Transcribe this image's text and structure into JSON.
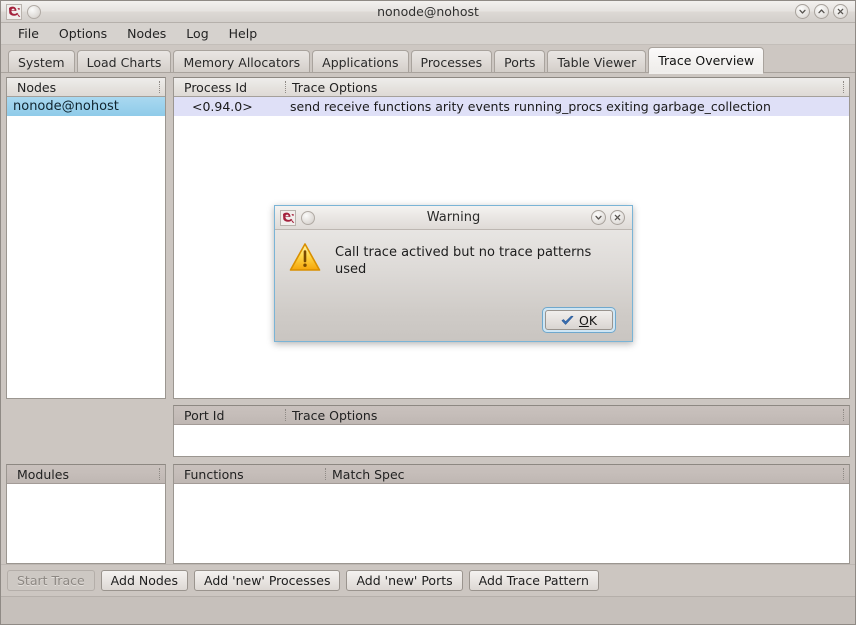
{
  "window": {
    "title": "nonode@nohost",
    "app_icon": "erlang-logo-icon",
    "controls": [
      {
        "name": "minimize",
        "glyph": "chevron-down-icon"
      },
      {
        "name": "maximize",
        "glyph": "chevron-up-icon"
      },
      {
        "name": "close",
        "glyph": "close-x-icon"
      }
    ]
  },
  "menubar": {
    "items": [
      {
        "label": "File"
      },
      {
        "label": "Options"
      },
      {
        "label": "Nodes"
      },
      {
        "label": "Log"
      },
      {
        "label": "Help"
      }
    ]
  },
  "tabs": {
    "active": "Trace Overview",
    "items": [
      {
        "label": "System",
        "active": false
      },
      {
        "label": "Load Charts",
        "active": false
      },
      {
        "label": "Memory Allocators",
        "active": false
      },
      {
        "label": "Applications",
        "active": false
      },
      {
        "label": "Processes",
        "active": false
      },
      {
        "label": "Ports",
        "active": false
      },
      {
        "label": "Table Viewer",
        "active": false
      },
      {
        "label": "Trace Overview",
        "active": true
      }
    ]
  },
  "nodes_panel": {
    "header": "Nodes",
    "rows": [
      {
        "node": "nonode@nohost",
        "selected": true
      }
    ]
  },
  "processes_panel": {
    "headers": {
      "id": "Process Id",
      "options": "Trace Options"
    },
    "rows": [
      {
        "id": "<0.94.0>",
        "options": "send receive functions arity events running_procs exiting garbage_collection",
        "selected": true
      }
    ]
  },
  "ports_panel": {
    "headers": {
      "id": "Port Id",
      "options": "Trace Options"
    },
    "rows": []
  },
  "modules_panel": {
    "header": "Modules",
    "rows": []
  },
  "functions_panel": {
    "headers": {
      "functions": "Functions",
      "match_spec": "Match Spec"
    },
    "rows": []
  },
  "buttonbar": {
    "buttons": [
      {
        "label": "Start Trace",
        "disabled": true
      },
      {
        "label": "Add Nodes",
        "disabled": false
      },
      {
        "label": "Add 'new' Processes",
        "disabled": false
      },
      {
        "label": "Add 'new' Ports",
        "disabled": false
      },
      {
        "label": "Add Trace Pattern",
        "disabled": false
      }
    ]
  },
  "statusbar": {
    "text": ""
  },
  "dialog": {
    "title": "Warning",
    "icon": "warning-triangle-icon",
    "app_icon": "erlang-logo-icon",
    "message": "Call trace actived but no trace patterns used",
    "ok_button": {
      "prefix": "",
      "mnemonic": "O",
      "suffix": "K",
      "icon": "check-mark-icon"
    },
    "controls": [
      {
        "name": "minimize",
        "glyph": "chevron-down-icon"
      },
      {
        "name": "close",
        "glyph": "close-x-icon"
      }
    ]
  },
  "colors": {
    "window_bg": "#cdc7c2",
    "selection_blue": "#dfe0f7",
    "node_selection": "#8fcbe9",
    "accent_focus": "#7ab4d6",
    "warning_yellow": "#ffd43b",
    "check_blue": "#3a72b8"
  }
}
